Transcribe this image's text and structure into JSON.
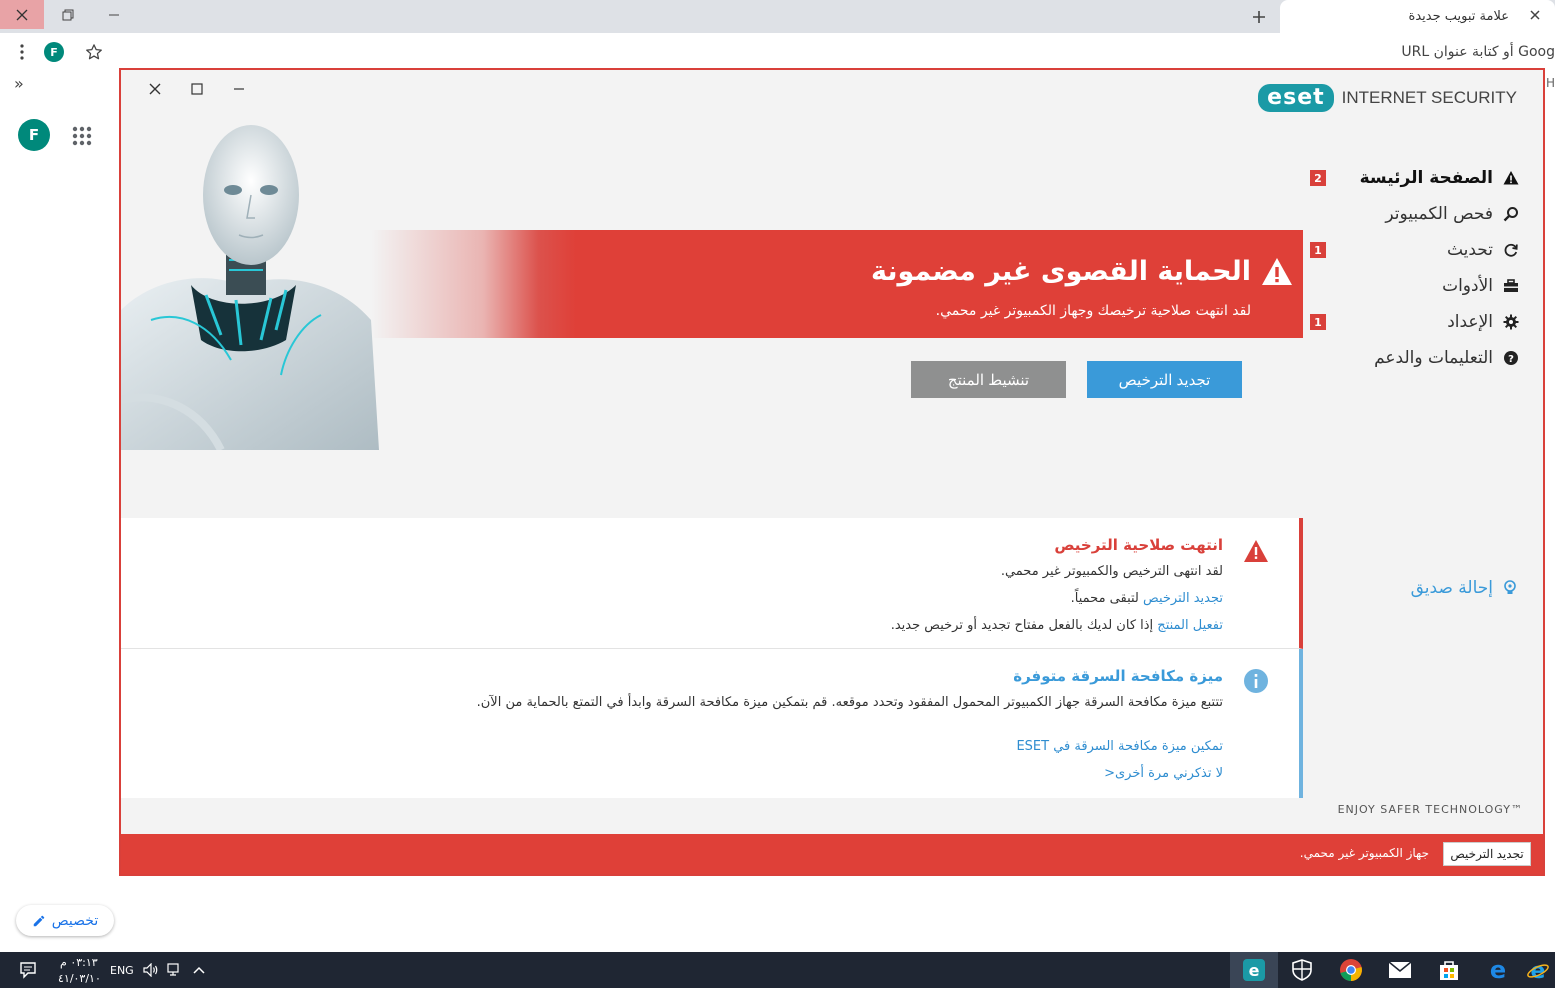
{
  "browser": {
    "tab_title": "علامة تبويب جديدة",
    "omnibox_placeholder": "Goog أو كتابة عنوان URL",
    "profile_initial": "F",
    "bookmarks_overflow": "»",
    "bookmark_partial": "H"
  },
  "newtab": {
    "profile_initial": "F",
    "customize_label": "تخصيص"
  },
  "eset": {
    "brand": "eset",
    "product": "INTERNET SECURITY",
    "nav": [
      {
        "label": "الصفحة الرئيسة",
        "icon": "warning-icon",
        "badge": "2"
      },
      {
        "label": "فحص الكمبيوتر",
        "icon": "search-icon",
        "badge": ""
      },
      {
        "label": "تحديث",
        "icon": "refresh-icon",
        "badge": "1"
      },
      {
        "label": "الأدوات",
        "icon": "toolbox-icon",
        "badge": ""
      },
      {
        "label": "الإعداد",
        "icon": "gear-icon",
        "badge": "1"
      },
      {
        "label": "التعليمات والدعم",
        "icon": "help-icon",
        "badge": ""
      }
    ],
    "alert": {
      "title": "الحماية القصوى غير مضمونة",
      "subtitle": "لقد انتهت صلاحية ترخيصك وجهاز الكمبيوتر غير محمي."
    },
    "buttons": {
      "renew": "تجديد الترخيص",
      "activate": "تنشيط المنتج"
    },
    "card_license": {
      "title": "انتهت صلاحية الترخيص",
      "line1": "لقد انتهى الترخيص والكمبيوتر غير محمي.",
      "line2_link": "تجديد الترخيص",
      "line2_rest": "لتبقى محمياً.",
      "line3_link": "تفعيل المنتج",
      "line3_rest": "إذا كان لديك بالفعل مفتاح تجديد أو ترخيص جديد."
    },
    "card_antitheft": {
      "title": "ميزة مكافحة السرقة متوفرة",
      "line1": "تتتبع ميزة مكافحة السرقة جهاز الكمبيوتر المحمول المفقود وتحدد موقعه. قم بتمكين ميزة مكافحة السرقة وابدأ في التمتع بالحماية من الآن.",
      "link1": "تمكين ميزة مكافحة السرقة في ESET",
      "link2": "لا تذكرني مرة أخرى<"
    },
    "refer_friend": "إحالة صديق",
    "tagline": "ENJOY SAFER TECHNOLOGY™",
    "status": {
      "button": "تجديد الترخيص",
      "text": "جهاز الكمبيوتر غير محمي."
    }
  },
  "taskbar": {
    "time": "٠٣:١٣ م",
    "date": "٤١/٠٣/١٠",
    "lang": "ENG",
    "notification_count": "١"
  },
  "colors": {
    "alert_red": "#df4038",
    "eset_teal": "#1b9aa6",
    "link_blue": "#2f8dd0",
    "button_blue": "#3a9ad9"
  }
}
